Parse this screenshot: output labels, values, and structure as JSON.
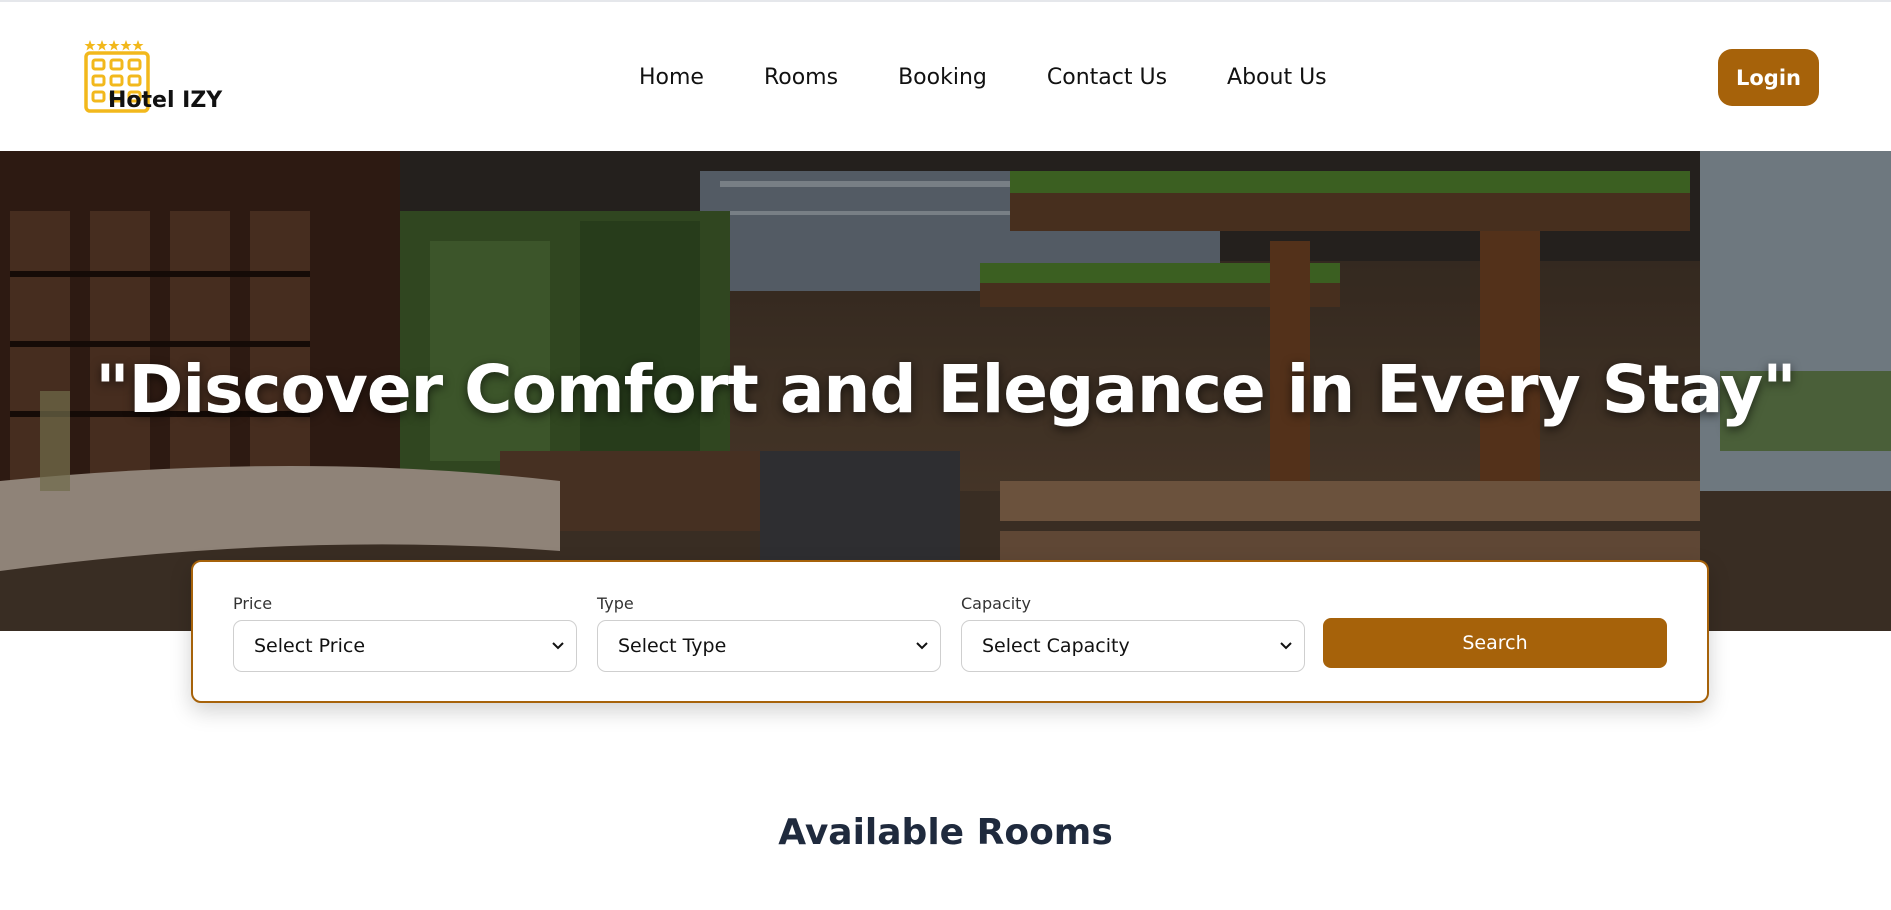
{
  "header": {
    "logo_text": "Hotel IZY",
    "nav": [
      "Home",
      "Rooms",
      "Booking",
      "Contact Us",
      "About Us"
    ],
    "login_label": "Login"
  },
  "hero": {
    "title": "\"Discover Comfort and Elegance in Every Stay\""
  },
  "search": {
    "price": {
      "label": "Price",
      "value": "Select Price"
    },
    "type": {
      "label": "Type",
      "value": "Select Type"
    },
    "capacity": {
      "label": "Capacity",
      "value": "Select Capacity"
    },
    "button_label": "Search"
  },
  "main": {
    "section_title": "Available Rooms"
  },
  "colors": {
    "accent": "#a6620a",
    "logo_gold": "#f2b81c",
    "heading": "#1f2a3d"
  },
  "icons": {
    "logo": "hotel-building-stars-icon",
    "select_arrow": "chevron-down-icon"
  }
}
